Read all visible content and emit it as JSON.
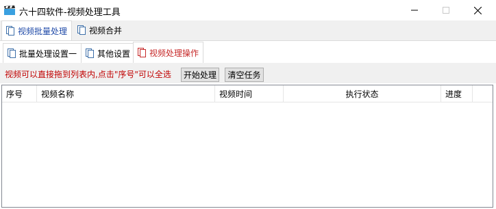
{
  "window": {
    "title": "六十四软件-视频处理工具",
    "icon": "clapperboard-icon",
    "controls": [
      "minimize-icon",
      "maximize-icon",
      "close-icon"
    ]
  },
  "main_tabs": [
    {
      "label": "视频批量处理",
      "icon": "document-icon",
      "active": true
    },
    {
      "label": "视频合并",
      "icon": "document-icon",
      "active": false
    }
  ],
  "sub_tabs": [
    {
      "label": "批量处理设置一",
      "icon": "document-icon",
      "active": false
    },
    {
      "label": "其他设置",
      "icon": "document-icon",
      "active": false
    },
    {
      "label": "视频处理操作",
      "icon": "document-icon",
      "active": true
    }
  ],
  "toolbar": {
    "hint": "视频可以直接拖到列表内,点击\"序号\"可以全选",
    "start_label": "开始处理",
    "clear_label": "清空任务"
  },
  "table": {
    "columns": [
      "序号",
      "视频名称",
      "视频时间",
      "执行状态",
      "进度"
    ],
    "rows": []
  },
  "colors": {
    "hint_text": "#c00000",
    "active_main_tab": "#1f4aa8",
    "active_sub_tab": "#c62828"
  }
}
